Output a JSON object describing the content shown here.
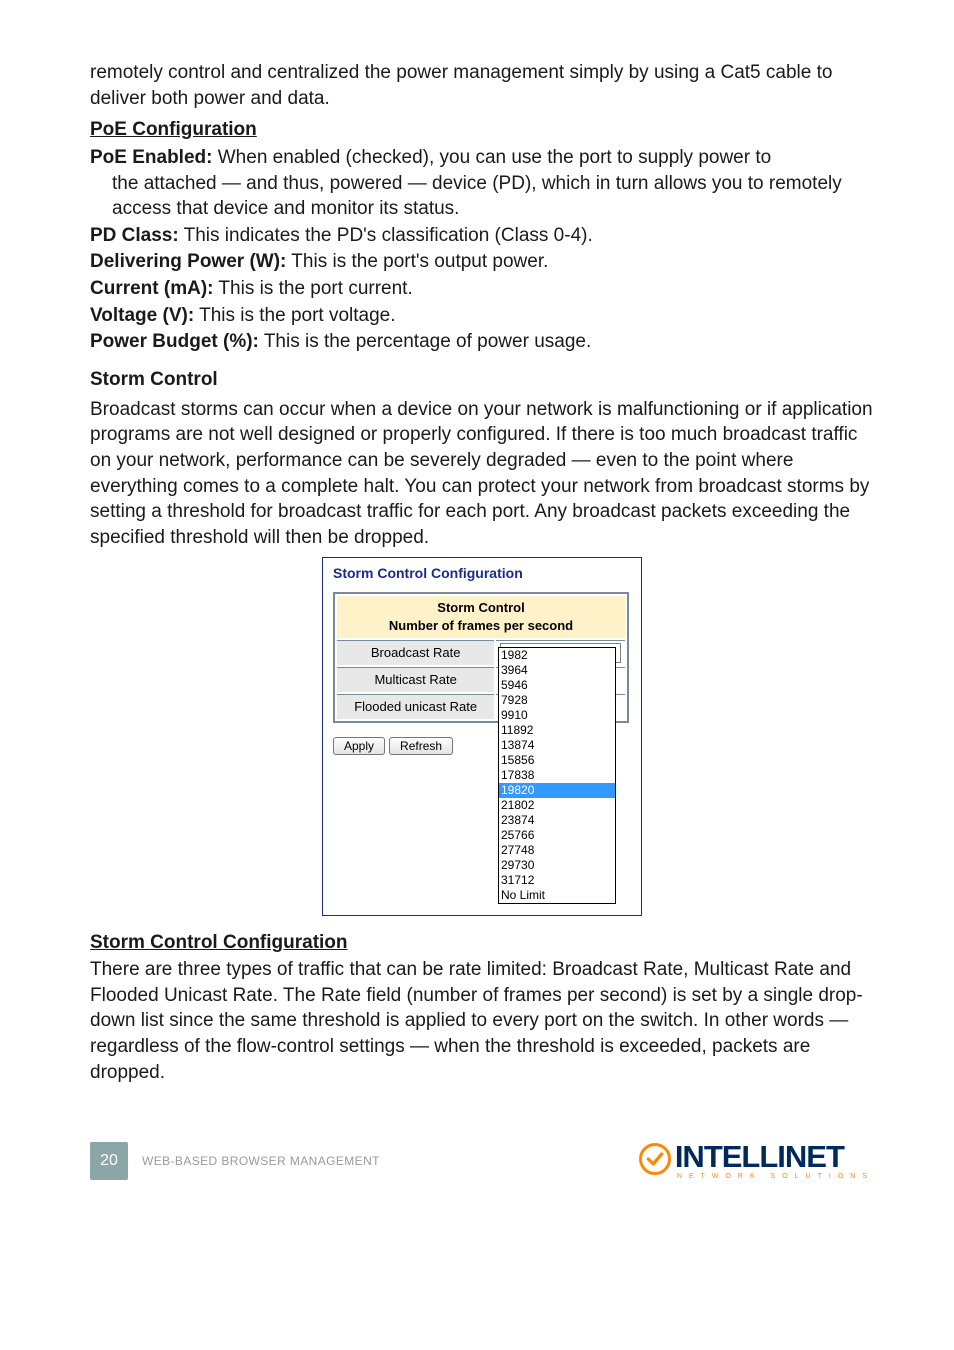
{
  "intro_para": "remotely control and centralized the power management simply by using a Cat5 cable to deliver both power and data.",
  "poe": {
    "heading": "PoE Configuration",
    "items": [
      {
        "term": "PoE Enabled:",
        "desc_line1": " When enabled (checked), you can use the port to supply power to",
        "desc_line2": "the attached — and thus, powered — device (PD), which in turn allows you to remotely access that device and monitor its status."
      },
      {
        "term": "PD Class:",
        "desc_line1": " This indicates the PD's classification (Class 0-4).",
        "desc_line2": ""
      },
      {
        "term": "Delivering Power (W):",
        "desc_line1": " This is the port's output power.",
        "desc_line2": ""
      },
      {
        "term": "Current (mA):",
        "desc_line1": " This is the port current.",
        "desc_line2": ""
      },
      {
        "term": "Voltage (V):",
        "desc_line1": " This is the port voltage.",
        "desc_line2": ""
      },
      {
        "term": "Power Budget (%):",
        "desc_line1": " This is the percentage of power usage.",
        "desc_line2": ""
      }
    ]
  },
  "storm": {
    "heading": "Storm Control",
    "para": "Broadcast storms can occur when a device on your network is malfunctioning or if application programs are not well designed or properly configured. If there is too much broadcast traffic on your network, performance can be severely degraded — even to the point where everything comes to a complete halt. You can protect your network from broadcast storms by setting a threshold for broadcast traffic for each port. Any broadcast packets exceeding the specified threshold will then be dropped.",
    "panel_title": "Storm Control Configuration",
    "table_header_l1": "Storm Control",
    "table_header_l2": "Number of frames per second",
    "rows": [
      {
        "label": "Broadcast Rate",
        "value": "9910"
      },
      {
        "label": "Multicast Rate",
        "value": ""
      },
      {
        "label": "Flooded unicast Rate",
        "value": ""
      }
    ],
    "options": [
      "1982",
      "3964",
      "5946",
      "7928",
      "9910",
      "11892",
      "13874",
      "15856",
      "17838",
      "19820",
      "21802",
      "23874",
      "25766",
      "27748",
      "29730",
      "31712",
      "No Limit"
    ],
    "selected_index": 9,
    "apply": "Apply",
    "refresh": "Refresh"
  },
  "storm_cfg": {
    "heading": "Storm Control Configuration",
    "para": "There are three types of traffic that can be rate limited: Broadcast Rate, Multicast Rate and Flooded Unicast Rate. The Rate field (number of frames per second) is set by a single drop-down list since the same threshold is applied to every port on the switch. In other words — regardless of the flow-control settings — when the threshold is exceeded, packets are dropped."
  },
  "footer": {
    "page": "20",
    "label": "WEB-BASED BROWSER MANAGEMENT",
    "logo_main": "INTELLINET",
    "logo_sub": "NETWORK SOLUTIONS"
  }
}
